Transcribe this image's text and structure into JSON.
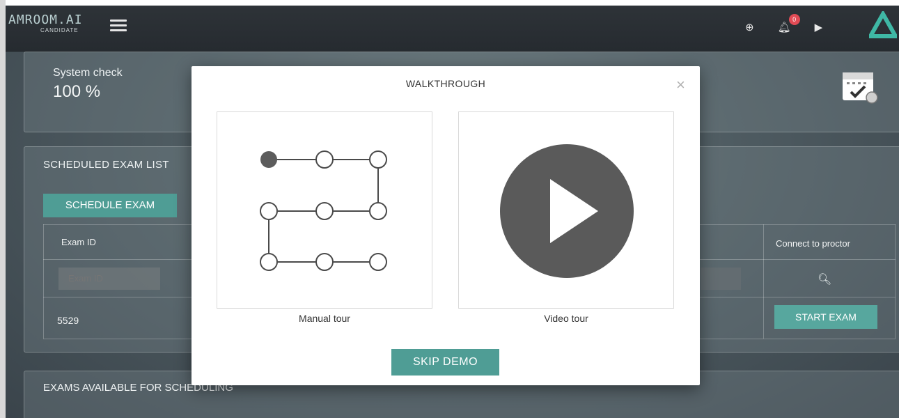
{
  "header": {
    "brand_name": "AMROOM.AI",
    "brand_sub": "CANDIDATE",
    "notification_count": "0",
    "icons": [
      "crosshair-icon",
      "bell-icon",
      "play-icon",
      "brand-triangle-icon"
    ]
  },
  "system_check": {
    "title": "System check",
    "value": "100 %"
  },
  "scheduled": {
    "title": "SCHEDULED EXAM LIST",
    "schedule_button": "SCHEDULE EXAM",
    "col_exam_id": "Exam ID",
    "col_connect": "Connect to proctor",
    "filter_placeholder": "Exam ID",
    "row_exam_id": "5529",
    "start_button": "START EXAM"
  },
  "available": {
    "title": "EXAMS AVAILABLE FOR SCHEDULING"
  },
  "modal": {
    "title": "WALKTHROUGH",
    "close": "×",
    "manual_label": "Manual tour",
    "video_label": "Video tour",
    "skip_button": "SKIP DEMO"
  },
  "colors": {
    "accent": "#4f9d95",
    "badge": "#e14b55",
    "topbar": "#2b3035",
    "icon_gray": "#5c5c5c"
  }
}
